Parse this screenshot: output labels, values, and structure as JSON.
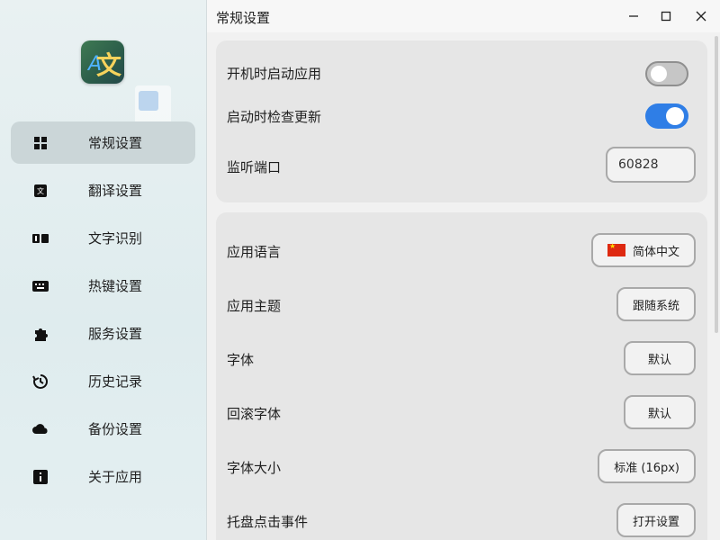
{
  "window": {
    "title": "常规设置",
    "minimize_icon": "minimize-icon",
    "maximize_icon": "maximize-icon",
    "close_icon": "close-icon"
  },
  "app": {
    "logo_text": "文",
    "logo_accent": "A"
  },
  "sidebar": {
    "items": [
      {
        "label": "常规设置",
        "icon": "grid-icon",
        "active": true
      },
      {
        "label": "翻译设置",
        "icon": "translate-icon",
        "active": false
      },
      {
        "label": "文字识别",
        "icon": "ocr-icon",
        "active": false
      },
      {
        "label": "热键设置",
        "icon": "keyboard-icon",
        "active": false
      },
      {
        "label": "服务设置",
        "icon": "puzzle-icon",
        "active": false
      },
      {
        "label": "历史记录",
        "icon": "history-icon",
        "active": false
      },
      {
        "label": "备份设置",
        "icon": "cloud-icon",
        "active": false
      },
      {
        "label": "关于应用",
        "icon": "info-icon",
        "active": false
      }
    ]
  },
  "settings": {
    "startup": {
      "label": "开机时启动应用",
      "enabled": false
    },
    "check_update": {
      "label": "启动时检查更新",
      "enabled": true
    },
    "port": {
      "label": "监听端口",
      "value": "60828"
    },
    "language": {
      "label": "应用语言",
      "value": "简体中文",
      "flag_icon": "china-flag-icon"
    },
    "theme": {
      "label": "应用主题",
      "value": "跟随系统"
    },
    "font": {
      "label": "字体",
      "value": "默认"
    },
    "fallback_font": {
      "label": "回滚字体",
      "value": "默认"
    },
    "font_size": {
      "label": "字体大小",
      "value": "标准 (16px)"
    },
    "tray_click": {
      "label": "托盘点击事件",
      "value": "打开设置"
    }
  },
  "colors": {
    "accent": "#2f7ee6",
    "active_nav": "#cbd6d8",
    "card_bg": "#e6e6e6"
  }
}
